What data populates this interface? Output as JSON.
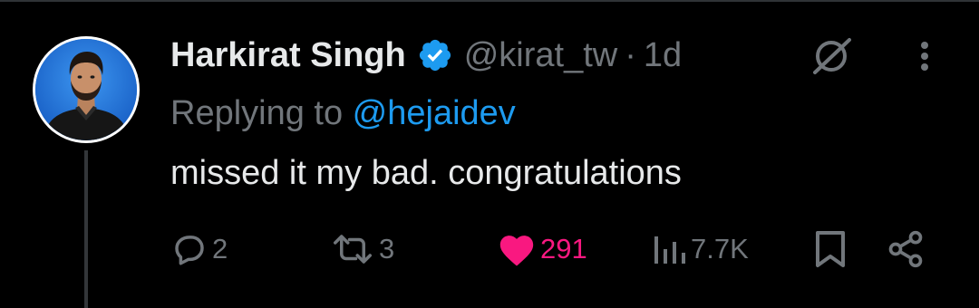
{
  "tweet": {
    "author": {
      "display_name": "Harkirat Singh",
      "handle": "@kirat_tw",
      "verified": true,
      "avatar": "profile-photo"
    },
    "separator": "·",
    "time": "1d",
    "reply": {
      "prefix": "Replying to ",
      "mention": "@hejaidev"
    },
    "text": "missed it my bad. congratulations",
    "actions": {
      "replies": "2",
      "reposts": "3",
      "likes": "291",
      "views": "7.7K",
      "liked": true
    }
  },
  "icons": {
    "verified": "verified-badge-icon",
    "grok": "grok-icon",
    "more": "more-vertical-icon",
    "reply": "reply-icon",
    "repost": "repost-icon",
    "like": "heart-icon",
    "views": "views-icon",
    "bookmark": "bookmark-icon",
    "share": "share-icon"
  },
  "colors": {
    "background": "#000000",
    "primary_text": "#e7e9ea",
    "secondary_text": "#71767b",
    "link": "#1d9bf0",
    "like": "#f91880",
    "verified": "#1d9bf0"
  }
}
